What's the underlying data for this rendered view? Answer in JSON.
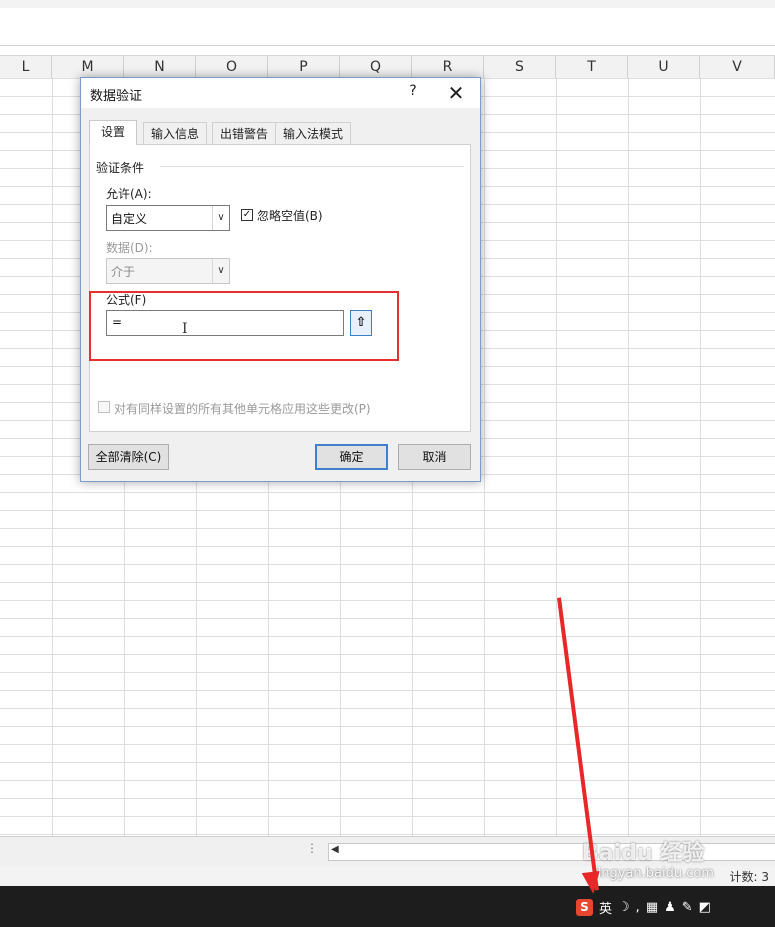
{
  "spreadsheet": {
    "columns": [
      "L",
      "M",
      "N",
      "O",
      "P",
      "Q",
      "R",
      "S",
      "T",
      "U",
      "V"
    ],
    "status_count": "计数: 3"
  },
  "dialog": {
    "title": "数据验证",
    "help": "?",
    "close": "✕",
    "tabs": [
      "设置",
      "输入信息",
      "出错警告",
      "输入法模式"
    ],
    "active_tab": "设置",
    "group_label": "验证条件",
    "allow_label": "允许(A):",
    "allow_value": "自定义",
    "ignore_blank_label": "忽略空值(B)",
    "ignore_blank_checked": true,
    "data_label": "数据(D):",
    "data_value": "介于",
    "formula_label": "公式(F)",
    "formula_value": "=",
    "apply_all_label": "对有同样设置的所有其他单元格应用这些更改(P)",
    "apply_all_checked": false,
    "clear_all_button": "全部清除(C)",
    "ok_button": "确定",
    "cancel_button": "取消"
  },
  "taskbar": {
    "ime_logo": "S",
    "ime_mode": "英",
    "ime_icons": [
      "moon-icon",
      "punctuation-icon",
      "keyboard-icon",
      "user-icon",
      "tools-icon",
      "skin-icon"
    ]
  },
  "watermark": {
    "text": "Baidu 经验",
    "url": "jingyan.baidu.com"
  },
  "colors": {
    "highlight_box": "#e53030",
    "arrow": "#e82828",
    "primary_button_border": "#3f7fcc",
    "taskbar": "#1d1d1d",
    "ime_logo": "#e8462e"
  }
}
